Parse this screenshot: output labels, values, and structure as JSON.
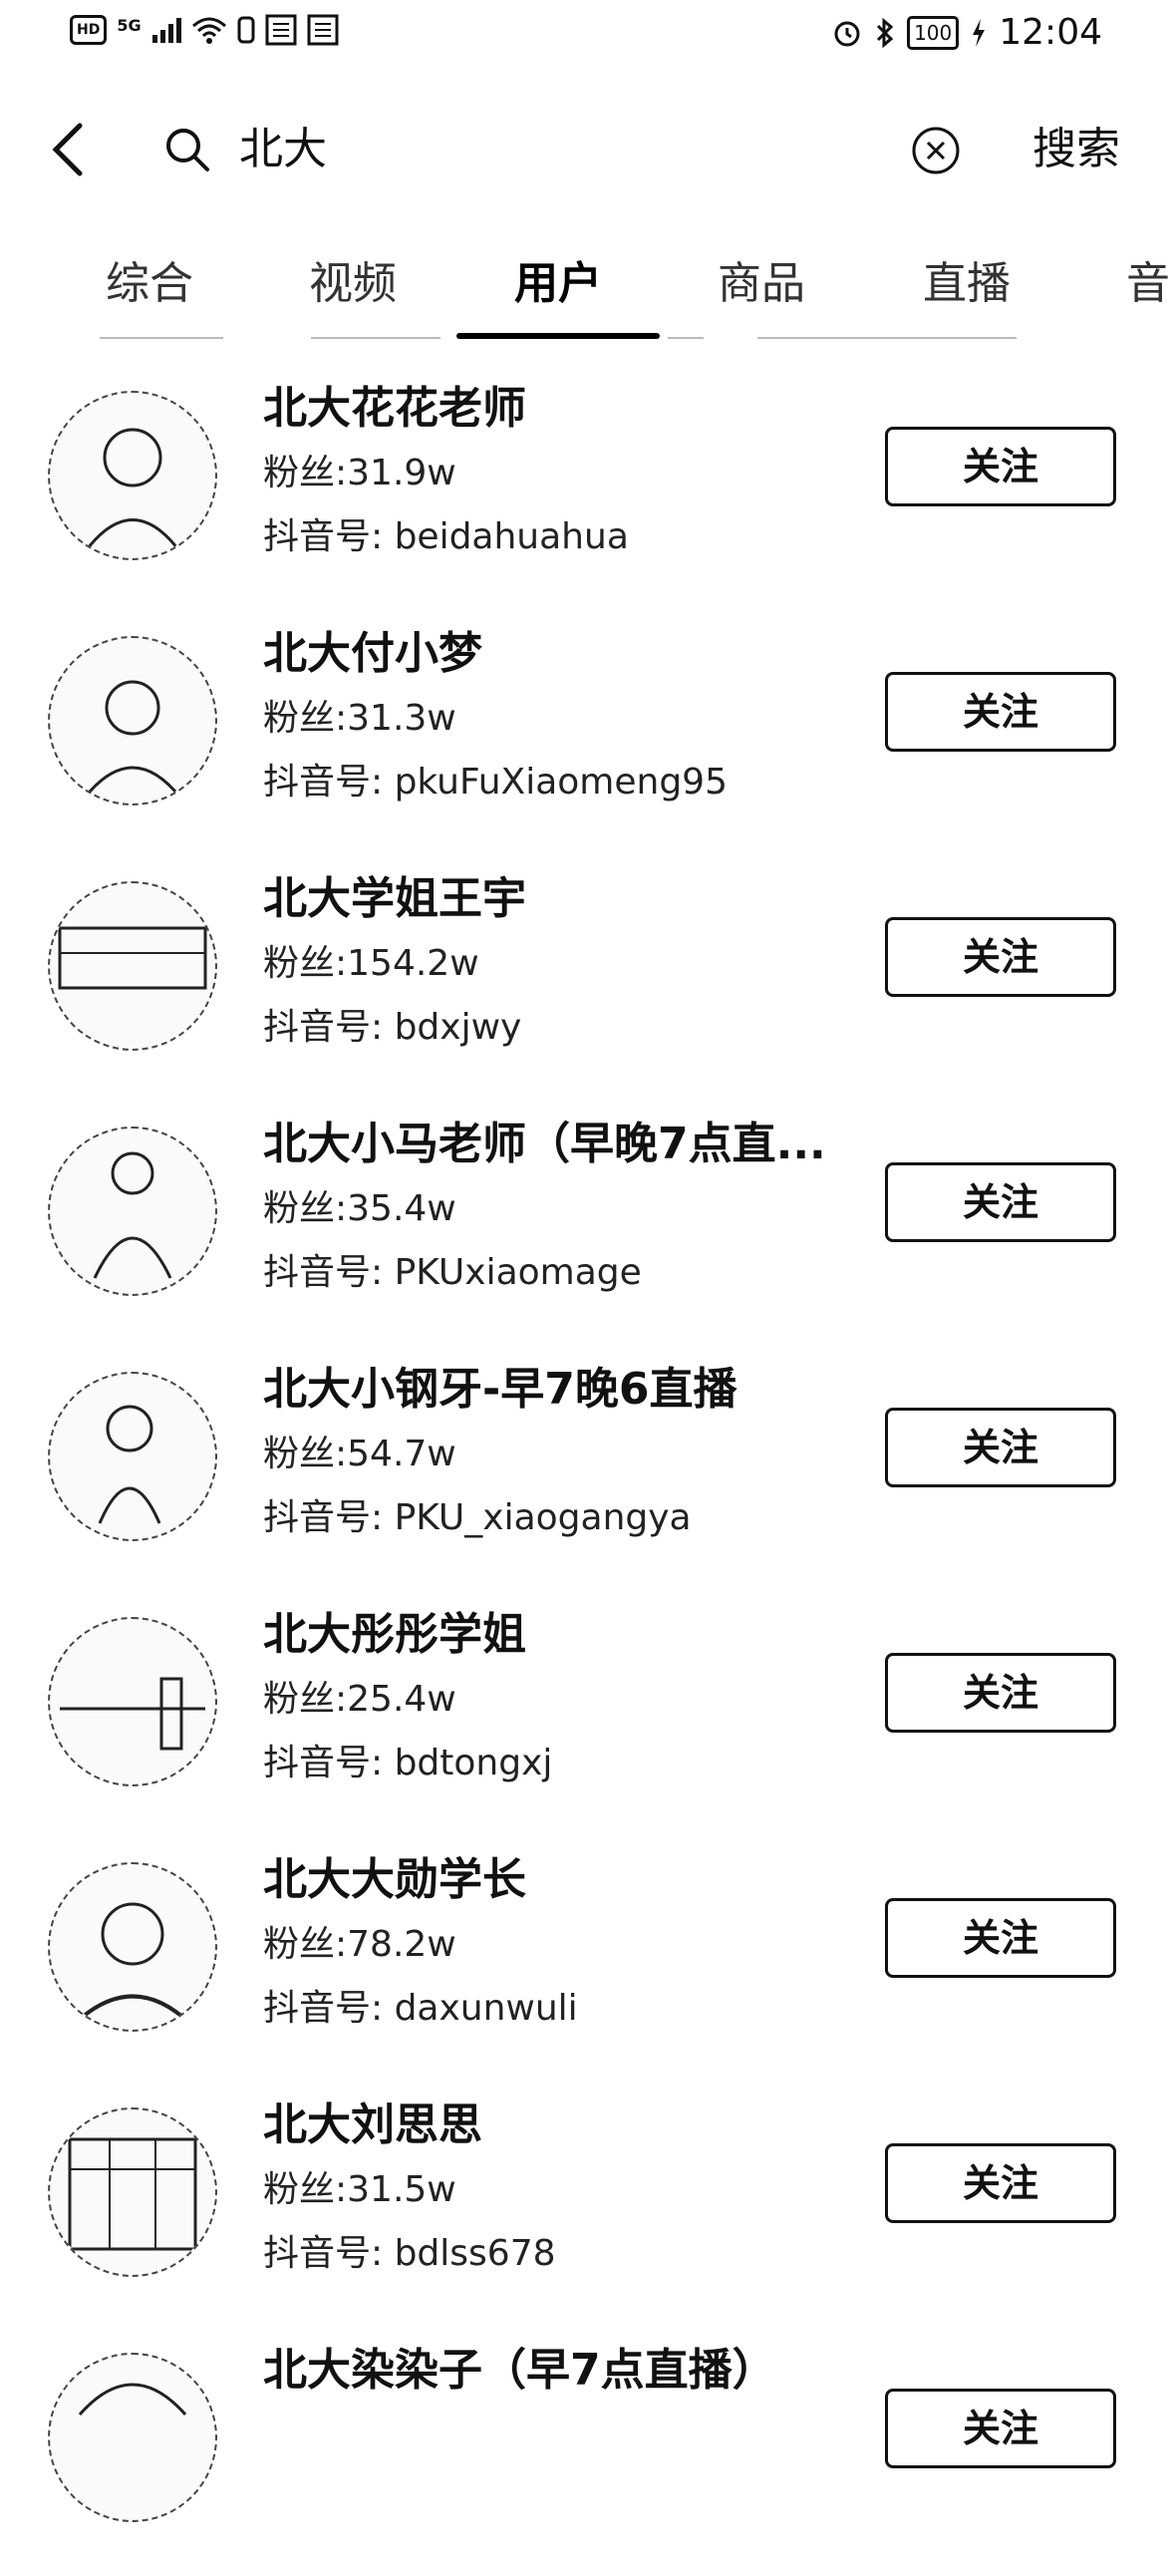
{
  "status_bar": {
    "left_badges": [
      "HD",
      "5G"
    ],
    "battery": "100",
    "time": "12:04"
  },
  "search": {
    "query": "北大",
    "search_label": "搜索"
  },
  "tabs": [
    {
      "label": "综合"
    },
    {
      "label": "视频"
    },
    {
      "label": "用户",
      "active": true
    },
    {
      "label": "商品"
    },
    {
      "label": "直播"
    },
    {
      "label": "音"
    }
  ],
  "follow_label": "关注",
  "users": [
    {
      "name": "北大花花老师",
      "fans": "粉丝:31.9w",
      "douyin_id": "抖音号: beidahuahua"
    },
    {
      "name": "北大付小梦",
      "fans": "粉丝:31.3w",
      "douyin_id": "抖音号: pkuFuXiaomeng95"
    },
    {
      "name": "北大学姐王宇",
      "fans": "粉丝:154.2w",
      "douyin_id": "抖音号: bdxjwy"
    },
    {
      "name": "北大小马老师（早晚7点直...",
      "fans": "粉丝:35.4w",
      "douyin_id": "抖音号: PKUxiaomage"
    },
    {
      "name": "北大小钢牙-早7晚6直播",
      "fans": "粉丝:54.7w",
      "douyin_id": "抖音号: PKU_xiaogangya"
    },
    {
      "name": "北大彤彤学姐",
      "fans": "粉丝:25.4w",
      "douyin_id": "抖音号: bdtongxj"
    },
    {
      "name": "北大大勋学长",
      "fans": "粉丝:78.2w",
      "douyin_id": "抖音号: daxunwuli"
    },
    {
      "name": "北大刘思思",
      "fans": "粉丝:31.5w",
      "douyin_id": "抖音号: bdlss678"
    },
    {
      "name": "北大染染子（早7点直播）",
      "fans": "",
      "douyin_id": ""
    }
  ]
}
